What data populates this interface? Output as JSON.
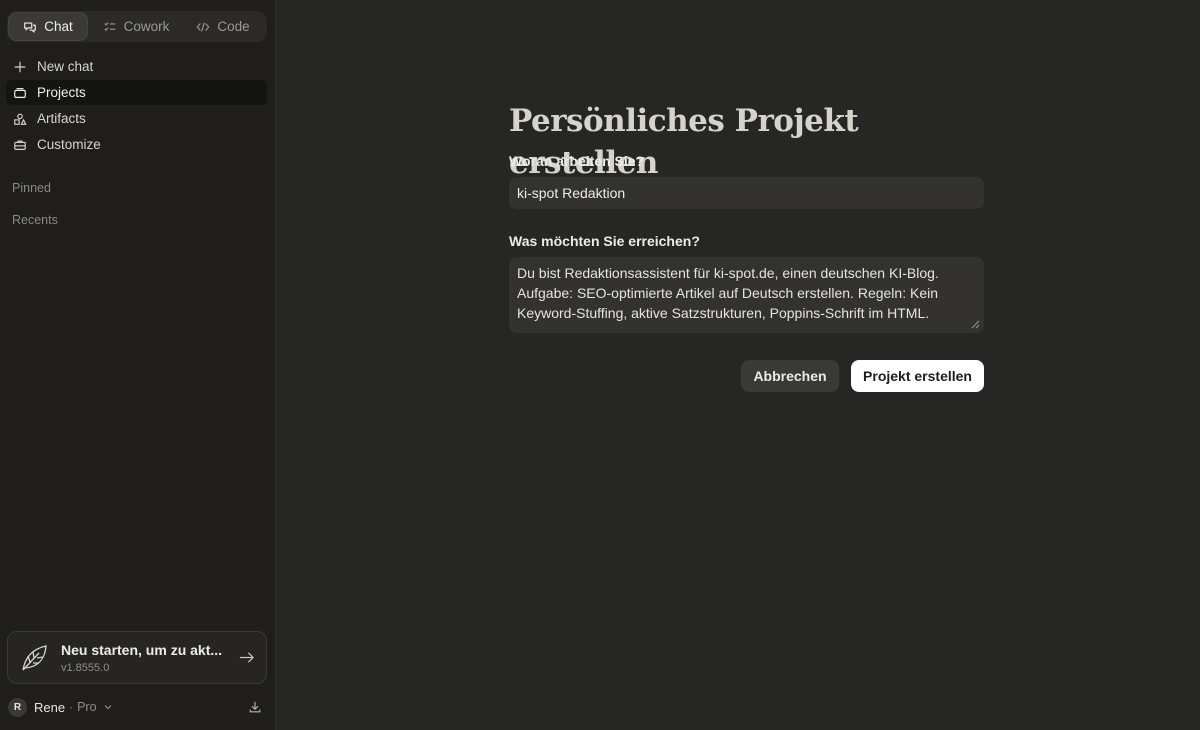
{
  "sidebar": {
    "modes": [
      {
        "label": "Chat",
        "icon": "chat-bubbles-icon",
        "active": true
      },
      {
        "label": "Cowork",
        "icon": "checklist-icon",
        "active": false
      },
      {
        "label": "Code",
        "icon": "code-icon",
        "active": false
      }
    ],
    "nav": [
      {
        "label": "New chat",
        "icon": "plus-icon"
      },
      {
        "label": "Projects",
        "icon": "folder-icon",
        "active": true
      },
      {
        "label": "Artifacts",
        "icon": "shapes-icon"
      },
      {
        "label": "Customize",
        "icon": "briefcase-icon"
      }
    ],
    "pinned_label": "Pinned",
    "recents_label": "Recents",
    "update": {
      "title": "Neu starten, um zu akt...",
      "version": "v1.8555.0",
      "icon": "leaf-icon"
    },
    "user": {
      "initial": "R",
      "name": "Rene",
      "separator": "·",
      "plan": "Pro"
    }
  },
  "form": {
    "title": "Persönliches Projekt erstellen",
    "name_label": "Woran arbeiten Sie?",
    "name_value": "ki-spot Redaktion",
    "goal_label": "Was möchten Sie erreichen?",
    "goal_value": "Du bist Redaktionsassistent für ki-spot.de, einen deutschen KI-Blog. Aufgabe: SEO-optimierte Artikel auf Deutsch erstellen. Regeln: Kein Keyword-Stuffing, aktive Satzstrukturen, Poppins-Schrift im HTML.",
    "cancel_label": "Abbrechen",
    "submit_label": "Projekt erstellen"
  },
  "colors": {
    "background": "#262624",
    "sidebar": "#1f1e1d",
    "field": "#333230",
    "primary_button": "#ffffff"
  }
}
